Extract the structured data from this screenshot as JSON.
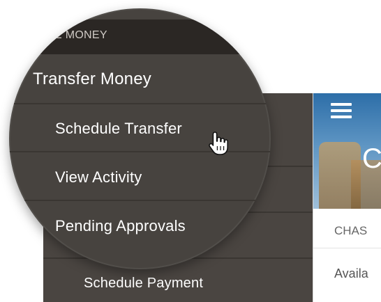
{
  "menu": {
    "section_label": "VE MONEY",
    "parent_item": "Transfer Money",
    "sub_items": [
      "Schedule Transfer",
      "View Activity",
      "Pending Approvals"
    ],
    "background_item": "Schedule Payment"
  },
  "app": {
    "hero_letter": "C",
    "account_name": "CHAS",
    "available_label": "Availa"
  },
  "colors": {
    "menu_bg": "#47433f",
    "section_bar": "#2b2724",
    "text": "#ffffff"
  },
  "icons": {
    "menu": "hamburger-icon",
    "cursor": "hand-pointer-icon"
  }
}
